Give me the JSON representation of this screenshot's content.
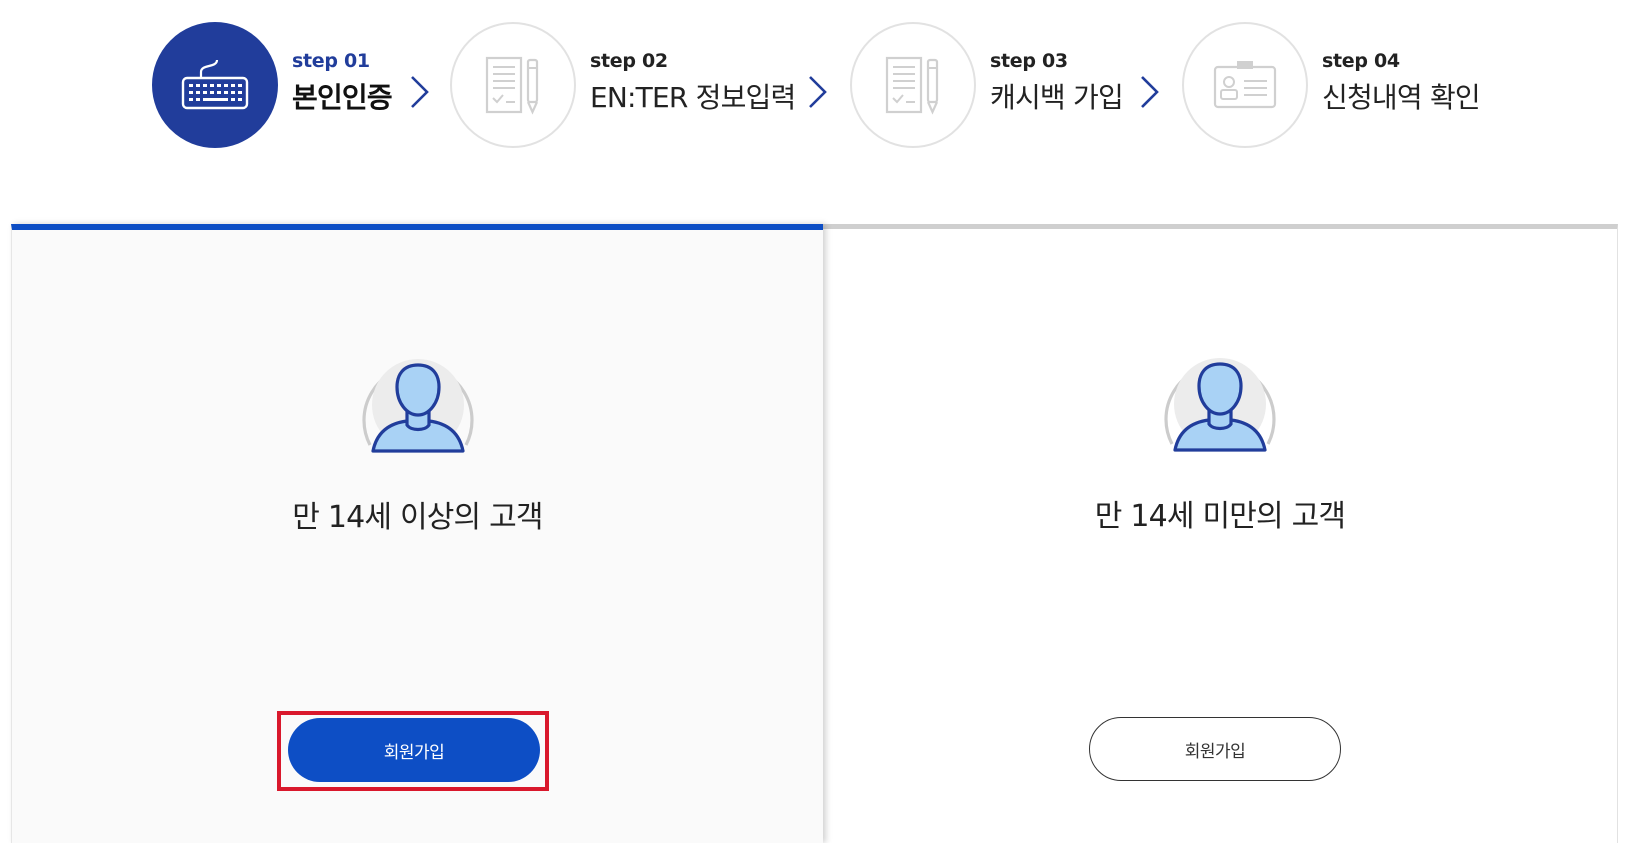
{
  "steps": [
    {
      "num": "step 01",
      "title": "본인인증",
      "icon": "keyboard-icon",
      "active": true
    },
    {
      "num": "step 02",
      "title": "EN:TER 정보입력",
      "icon": "document-pencil-icon",
      "active": false
    },
    {
      "num": "step 03",
      "title": "캐시백 가입",
      "icon": "document-pencil-icon",
      "active": false
    },
    {
      "num": "step 04",
      "title": "신청내역 확인",
      "icon": "id-card-icon",
      "active": false
    }
  ],
  "panels": {
    "adult": {
      "label": "만 14세 이상의 고객",
      "button": "회원가입",
      "icon": "user-avatar-icon"
    },
    "minor": {
      "label": "만 14세 미만의 고객",
      "button": "회원가입",
      "icon": "user-avatar-icon"
    }
  },
  "colors": {
    "primary": "#0d4ec5",
    "step_active": "#213d9b",
    "highlight": "#d9182c",
    "avatar_fill": "#a9d2f5",
    "avatar_stroke": "#213d9b"
  }
}
